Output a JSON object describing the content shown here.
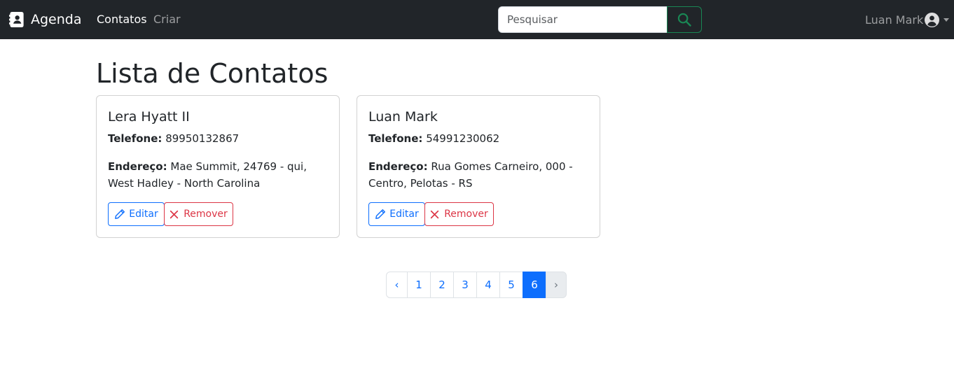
{
  "navbar": {
    "brand": "Agenda",
    "links": [
      {
        "label": "Contatos"
      },
      {
        "label": "Criar"
      }
    ],
    "search": {
      "placeholder": "Pesquisar",
      "value": ""
    },
    "user": {
      "name": "Luan Mark"
    }
  },
  "main": {
    "title": "Lista de Contatos",
    "contacts": [
      {
        "name": "Lera Hyatt II",
        "phone_label": "Telefone:",
        "phone": "89950132867",
        "address_label": "Endereço:",
        "address": "Mae Summit, 24769 - qui, West Hadley - North Carolina",
        "edit_label": "Editar",
        "remove_label": "Remover"
      },
      {
        "name": "Luan Mark",
        "phone_label": "Telefone:",
        "phone": "54991230062",
        "address_label": "Endereço:",
        "address": "Rua Gomes Carneiro, 000 - Centro, Pelotas - RS",
        "edit_label": "Editar",
        "remove_label": "Remover"
      }
    ],
    "pagination": {
      "prev": "‹",
      "pages": [
        "1",
        "2",
        "3",
        "4",
        "5",
        "6"
      ],
      "current": "6",
      "next": "›"
    }
  },
  "colors": {
    "navbar_bg": "#212529",
    "primary": "#0d6efd",
    "danger": "#dc3545",
    "success": "#198754"
  },
  "icons": [
    "address-book-icon",
    "search-icon",
    "user-circle-icon",
    "caret-down-icon",
    "pencil-icon",
    "x-icon"
  ]
}
